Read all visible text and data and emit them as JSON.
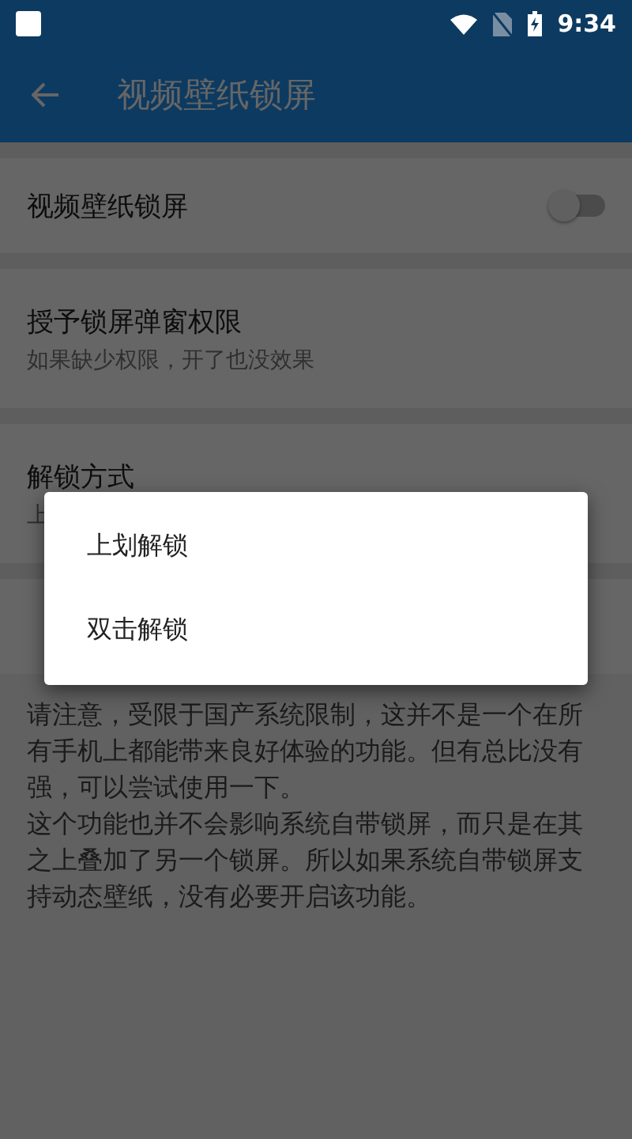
{
  "status_bar": {
    "time": "9:34"
  },
  "app_bar": {
    "title": "视频壁纸锁屏"
  },
  "settings": [
    {
      "kind": "switch",
      "title": "视频壁纸锁屏",
      "on": false
    },
    {
      "kind": "text",
      "title": "授予锁屏弹窗权限",
      "subtitle": "如果缺少权限，开了也没效果"
    },
    {
      "kind": "text",
      "title": "解锁方式",
      "subtitle": "上"
    },
    {
      "kind": "blank"
    }
  ],
  "note": [
    "请注意，受限于国产系统限制，这并不是一个在所有手机上都能带来良好体验的功能。但有总比没有强，可以尝试使用一下。",
    "这个功能也并不会影响系统自带锁屏，而只是在其之上叠加了另一个锁屏。所以如果系统自带锁屏支持动态壁纸，没有必要开启该功能。"
  ],
  "dialog": {
    "options": [
      {
        "label": "上划解锁"
      },
      {
        "label": "双击解锁"
      }
    ]
  }
}
